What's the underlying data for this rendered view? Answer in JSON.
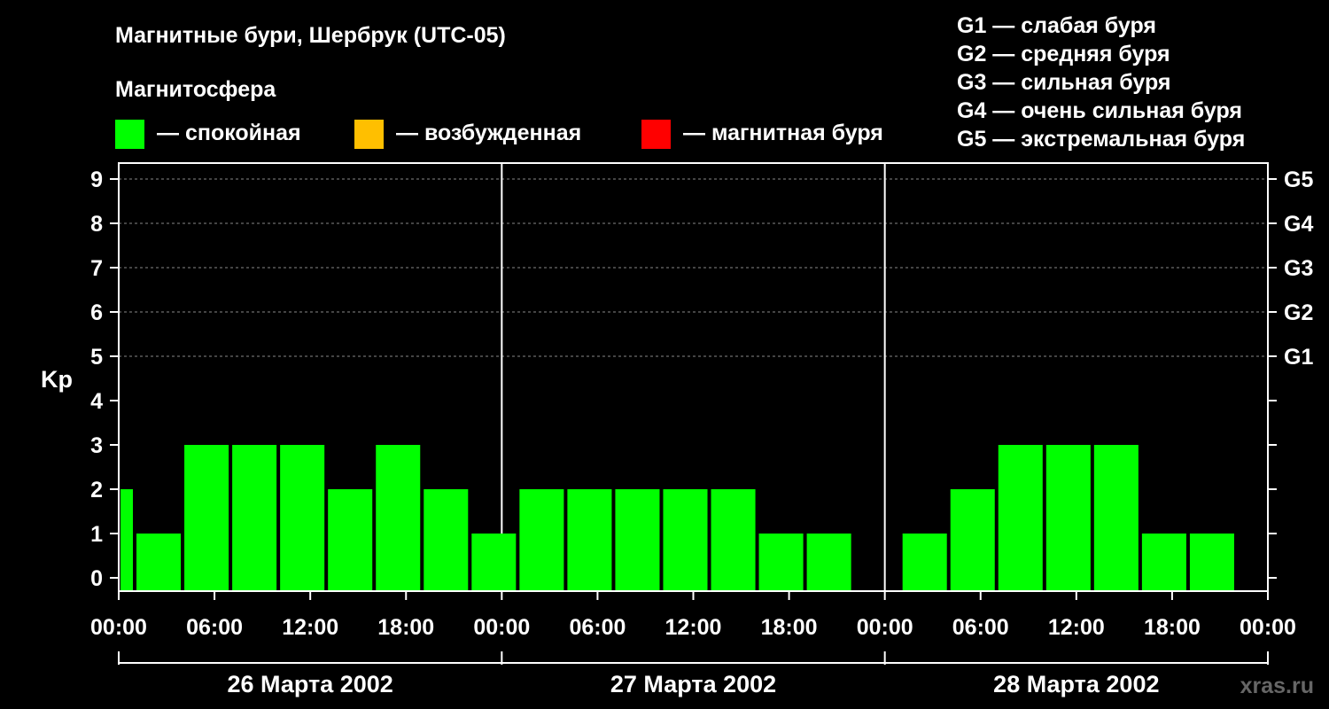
{
  "chart_data": {
    "type": "bar",
    "title": "Магнитные бури, Шербрук (UTC-05)",
    "legend_title": "Магнитосфера",
    "legend": [
      {
        "label": "— спокойная",
        "color": "#00ff00"
      },
      {
        "label": "— возбужденная",
        "color": "#ffbf00"
      },
      {
        "label": "— магнитная буря",
        "color": "#ff0000"
      }
    ],
    "g_scale": [
      "G1 — слабая буря",
      "G2 — средняя буря",
      "G3 — сильная буря",
      "G4 — очень сильная буря",
      "G5 — экстремальная буря"
    ],
    "ylabel": "Kp",
    "ylim": [
      0,
      9
    ],
    "yticks": [
      "0",
      "1",
      "2",
      "3",
      "4",
      "5",
      "6",
      "7",
      "8",
      "9"
    ],
    "right_ticks": [
      {
        "value": 5,
        "label": "G1"
      },
      {
        "value": 6,
        "label": "G2"
      },
      {
        "value": 7,
        "label": "G3"
      },
      {
        "value": 8,
        "label": "G4"
      },
      {
        "value": 9,
        "label": "G5"
      }
    ],
    "grid": true,
    "xlim_hours": [
      0,
      72
    ],
    "xtick_labels": [
      "00:00",
      "06:00",
      "12:00",
      "18:00",
      "00:00",
      "06:00",
      "12:00",
      "18:00",
      "00:00",
      "06:00",
      "12:00",
      "18:00",
      "00:00"
    ],
    "days": [
      "26 Марта 2002",
      "27 Марта 2002",
      "28 Марта 2002"
    ],
    "bars": [
      {
        "start": 0,
        "end": 1,
        "kp": 2
      },
      {
        "start": 1,
        "end": 4,
        "kp": 1
      },
      {
        "start": 4,
        "end": 7,
        "kp": 3
      },
      {
        "start": 7,
        "end": 10,
        "kp": 3
      },
      {
        "start": 10,
        "end": 13,
        "kp": 3
      },
      {
        "start": 13,
        "end": 16,
        "kp": 2
      },
      {
        "start": 16,
        "end": 19,
        "kp": 3
      },
      {
        "start": 19,
        "end": 22,
        "kp": 2
      },
      {
        "start": 22,
        "end": 25,
        "kp": 1
      },
      {
        "start": 25,
        "end": 28,
        "kp": 2
      },
      {
        "start": 28,
        "end": 31,
        "kp": 2
      },
      {
        "start": 31,
        "end": 34,
        "kp": 2
      },
      {
        "start": 34,
        "end": 37,
        "kp": 2
      },
      {
        "start": 37,
        "end": 40,
        "kp": 2
      },
      {
        "start": 40,
        "end": 43,
        "kp": 1
      },
      {
        "start": 43,
        "end": 46,
        "kp": 1
      },
      {
        "start": 49,
        "end": 52,
        "kp": 1
      },
      {
        "start": 52,
        "end": 55,
        "kp": 2
      },
      {
        "start": 55,
        "end": 58,
        "kp": 3
      },
      {
        "start": 58,
        "end": 61,
        "kp": 3
      },
      {
        "start": 61,
        "end": 64,
        "kp": 3
      },
      {
        "start": 64,
        "end": 67,
        "kp": 1
      },
      {
        "start": 67,
        "end": 70,
        "kp": 1
      }
    ],
    "bar_color": "#00ff00",
    "watermark": "xras.ru"
  }
}
